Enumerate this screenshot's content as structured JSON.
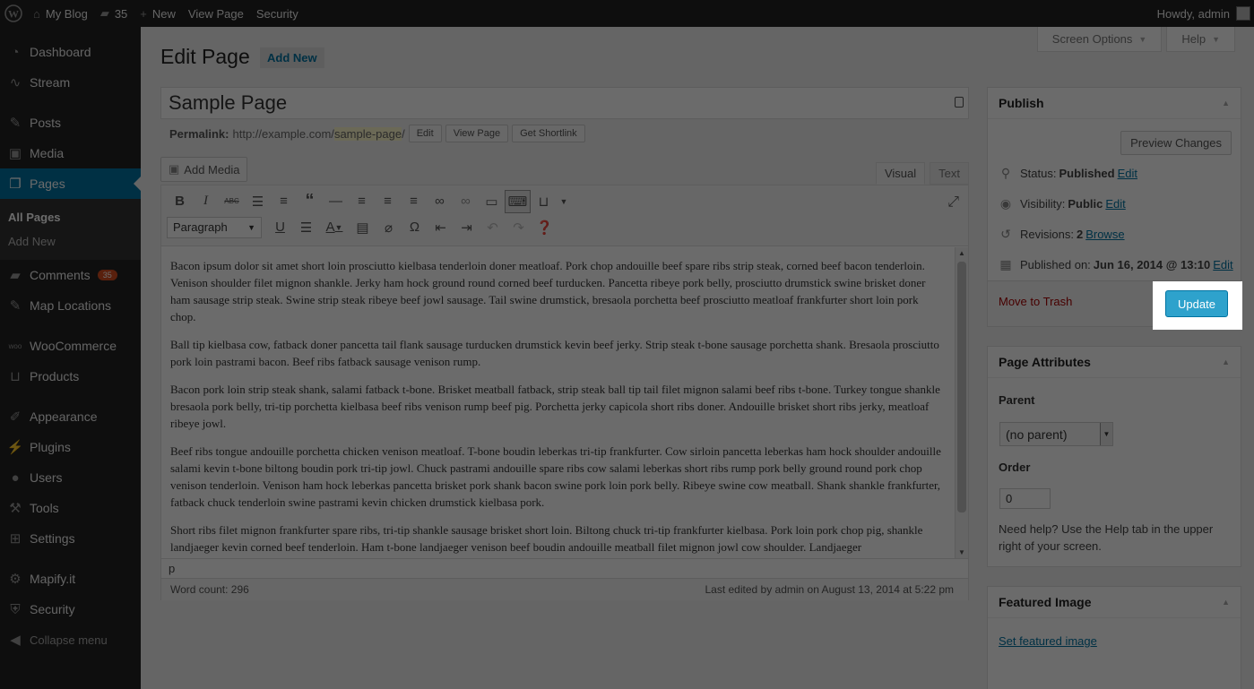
{
  "adminbar": {
    "site_name": "My Blog",
    "comments_count": "35",
    "new_label": "New",
    "view_page": "View Page",
    "security": "Security",
    "howdy": "Howdy, admin"
  },
  "sidebar": {
    "dashboard": "Dashboard",
    "stream": "Stream",
    "posts": "Posts",
    "media": "Media",
    "pages": "Pages",
    "all_pages": "All Pages",
    "add_new": "Add New",
    "comments": "Comments",
    "comments_badge": "35",
    "map_locations": "Map Locations",
    "woocommerce": "WooCommerce",
    "products": "Products",
    "appearance": "Appearance",
    "plugins": "Plugins",
    "users": "Users",
    "tools": "Tools",
    "settings": "Settings",
    "mapify": "Mapify.it",
    "security": "Security",
    "collapse": "Collapse menu"
  },
  "screen_tabs": {
    "screen_options": "Screen Options",
    "help": "Help"
  },
  "header": {
    "title": "Edit Page",
    "add_new": "Add New"
  },
  "post": {
    "title": "Sample Page",
    "permalink_label": "Permalink:",
    "permalink_base": "http://example.com/",
    "permalink_slug": "sample-page",
    "permalink_trail": "/",
    "edit_btn": "Edit",
    "view_btn": "View Page",
    "shortlink_btn": "Get Shortlink"
  },
  "editor": {
    "add_media": "Add Media",
    "tab_visual": "Visual",
    "tab_text": "Text",
    "format": "Paragraph",
    "paragraphs": [
      "Bacon ipsum dolor sit amet short loin prosciutto kielbasa tenderloin doner meatloaf. Pork chop andouille beef spare ribs strip steak, corned beef bacon tenderloin. Venison shoulder filet mignon shankle. Jerky ham hock ground round corned beef turducken. Pancetta ribeye pork belly, prosciutto drumstick swine brisket doner ham sausage strip steak. Swine strip steak ribeye beef jowl sausage. Tail swine drumstick, bresaola porchetta beef prosciutto meatloaf frankfurter short loin pork chop.",
      "Ball tip kielbasa cow, fatback doner pancetta tail flank sausage turducken drumstick kevin beef jerky. Strip steak t-bone sausage porchetta shank. Bresaola prosciutto pork loin pastrami bacon. Beef ribs fatback sausage venison rump.",
      "Bacon pork loin strip steak shank, salami fatback t-bone. Brisket meatball fatback, strip steak ball tip tail filet mignon salami beef ribs t-bone. Turkey tongue shankle bresaola pork belly, tri-tip porchetta kielbasa beef ribs venison rump beef pig. Porchetta jerky capicola short ribs doner. Andouille brisket short ribs jerky, meatloaf ribeye jowl.",
      "Beef ribs tongue andouille porchetta chicken venison meatloaf. T-bone boudin leberkas tri-tip frankfurter. Cow sirloin pancetta leberkas ham hock shoulder andouille salami kevin t-bone biltong boudin pork tri-tip jowl. Chuck pastrami andouille spare ribs cow salami leberkas short ribs rump pork belly ground round pork chop venison tenderloin. Venison ham hock leberkas pancetta brisket pork shank bacon swine pork loin pork belly. Ribeye swine cow meatball. Shank shankle frankfurter, fatback chuck tenderloin swine pastrami kevin chicken drumstick kielbasa pork.",
      "Short ribs filet mignon frankfurter spare ribs, tri-tip shankle sausage brisket short loin. Biltong chuck tri-tip frankfurter kielbasa. Pork loin pork chop pig, shankle landjaeger kevin corned beef tenderloin. Ham t-bone landjaeger venison beef boudin andouille meatball filet mignon jowl cow shoulder. Landjaeger"
    ],
    "path": "p",
    "word_count": "Word count: 296",
    "last_edited": "Last edited by admin on August 13, 2014 at 5:22 pm"
  },
  "publish": {
    "title": "Publish",
    "preview": "Preview Changes",
    "status_label": "Status:",
    "status_value": "Published",
    "visibility_label": "Visibility:",
    "visibility_value": "Public",
    "revisions_label": "Revisions:",
    "revisions_value": "2",
    "browse": "Browse",
    "published_label": "Published on:",
    "published_value": "Jun 16, 2014 @ 13:10",
    "edit": "Edit",
    "trash": "Move to Trash",
    "update": "Update"
  },
  "attributes": {
    "title": "Page Attributes",
    "parent_label": "Parent",
    "parent_value": "(no parent)",
    "order_label": "Order",
    "order_value": "0",
    "help": "Need help? Use the Help tab in the upper right of your screen."
  },
  "featured": {
    "title": "Featured Image",
    "link": "Set featured image"
  },
  "colors": {
    "accent": "#0074a2",
    "button": "#2ea2cc",
    "trash": "#a00"
  }
}
